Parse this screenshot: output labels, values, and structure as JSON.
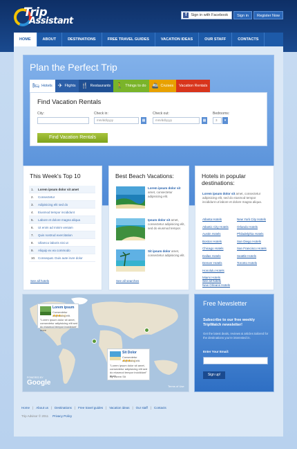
{
  "brand": {
    "line1": "Trip",
    "line2": "Assistant"
  },
  "topbar": {
    "facebook_label": "Sign in with Facebook",
    "signin_label": "Sign in",
    "register_label": "Register Now"
  },
  "nav": [
    "HOME",
    "ABOUT",
    "DESTINATIONS",
    "FREE TRAVEL GUIDES",
    "VACATION IDEAS",
    "OUR STAFF",
    "CONTACTS"
  ],
  "hero": {
    "title": "Plan the Perfect Trip",
    "tabs": [
      {
        "label": "Hotels",
        "icon": "bed-icon"
      },
      {
        "label": "Flights",
        "icon": "plane-icon"
      },
      {
        "label": "Restaurants",
        "icon": "fork-knife-icon"
      },
      {
        "label": "Things to do",
        "icon": "walking-person-icon"
      },
      {
        "label": "Cruises",
        "icon": "ship-icon"
      },
      {
        "label": "Vacation Rentals",
        "icon": ""
      }
    ],
    "search": {
      "title": "Find Vacation Rentals",
      "city_label": "City:",
      "checkin_label": "Check in:",
      "checkout_label": "Check out:",
      "bedrooms_label": "Bedrooms:",
      "checkin_placeholder": "mm/dd/yyyy",
      "checkout_placeholder": "mm/dd/yyyy",
      "bedrooms_value": "3",
      "button": "Find Vacation Rentals"
    }
  },
  "top10": {
    "title": "This Week's Top 10",
    "items": [
      {
        "n": "1.",
        "text": "Lorem ipsum dolor sit amet",
        "bold": true
      },
      {
        "n": "2.",
        "text": "Consectetur",
        "bold": false
      },
      {
        "n": "3.",
        "text": "Adipisicing elit sed do",
        "bold": false
      },
      {
        "n": "4.",
        "text": "Eiusmod tempor incididunt",
        "bold": false
      },
      {
        "n": "5.",
        "text": "Labore et dolore magna aliqua",
        "bold": false
      },
      {
        "n": "6.",
        "text": "Ut enim ad minim veniam",
        "bold": false
      },
      {
        "n": "7.",
        "text": "Quis nostrud exercitation",
        "bold": false
      },
      {
        "n": "8.",
        "text": "Ullamco laboris nisi ut",
        "bold": false
      },
      {
        "n": "9.",
        "text": "Aliquip ex ea commodo",
        "bold": false
      },
      {
        "n": "10.",
        "text": "Consequat. Duis aute irure dolor",
        "bold": false
      }
    ],
    "link": "See all hotels"
  },
  "beach": {
    "title": "Best Beach Vacations:",
    "items": [
      {
        "title": "Lorem ipsum dolor sit",
        "text": "amet, consectetur adipisicing elit."
      },
      {
        "title": "Ipsum dolor sit",
        "text": "amet, consectetur adipisicing elit, sed do eiusmod tempor."
      },
      {
        "title": "Sit ipsum dolor",
        "text": "amet, consectetur adipisicing elit."
      }
    ],
    "link": "See all searches"
  },
  "hotels": {
    "title_line1": "Hotels in popular",
    "title_line2": "destinations:",
    "intro_bold": "Lorem ipsum dolor sit",
    "intro_rest": "amet, consectetur adipisicing elit, sed do eiusmod tempor incididunt ut labore et dolore magna aliqua.",
    "cities": [
      "Atlanta Hotels",
      "New York City Hotels",
      "Atlantic City Hotels",
      "Orlando Hotels",
      "Austin Hotels",
      "Philadelphia Hotels",
      "Boston Hotels",
      "San Diego Hotels",
      "Chicago Hotels",
      "San Francisco Hotels",
      "Dallas Hotels",
      "Seattle Hotels",
      "Denver Hotels",
      "Toronto Hotels",
      "Honolulu Hotels",
      "",
      "Miami Hotels",
      "",
      "New Orleans Hotels",
      ""
    ],
    "link": "See all hotels"
  },
  "map": {
    "card1": {
      "title": "Lorem ipsum",
      "sub": "Consectetur adipisicing elit.",
      "rating": 3,
      "text": "\"Lorem ipsum dolor sit amet, consectetur adipisicing elit sed do eiusmod tempor incididunt\" more",
      "by": "By Lorem Sit"
    },
    "card2": {
      "title": "Sit Dolor",
      "sub": "Consectetur adipisicing elit.",
      "rating": 3,
      "text": "\"Lorem ipsum dolor sit amet, consectetur adipisicing elit sed do eiusmod tempor incididunt\" more",
      "by": "By Lorem Sit"
    },
    "powered": "POWERED BY",
    "google": "Google",
    "terms": "Terms of Use"
  },
  "newsletter": {
    "title": "Free Newsletter",
    "subtitle": "Subscribe to our free weekly TripWatch newsletter!",
    "text": "Get the latest deals, reviews & articles tailored for the destinations you're interested in.",
    "email_label": "Enter Your Email:",
    "button": "Sign up!"
  },
  "footer": {
    "links": [
      "Home",
      "About us",
      "Destinations",
      "Free travel guides",
      "Vacation ideas",
      "Our staff",
      "Contacts"
    ],
    "copyright": "Trip Advisor © 2011",
    "privacy": "Privacy Policy"
  },
  "colors": {
    "brand_blue": "#1d5aa8",
    "accent_green": "#7da21b"
  }
}
